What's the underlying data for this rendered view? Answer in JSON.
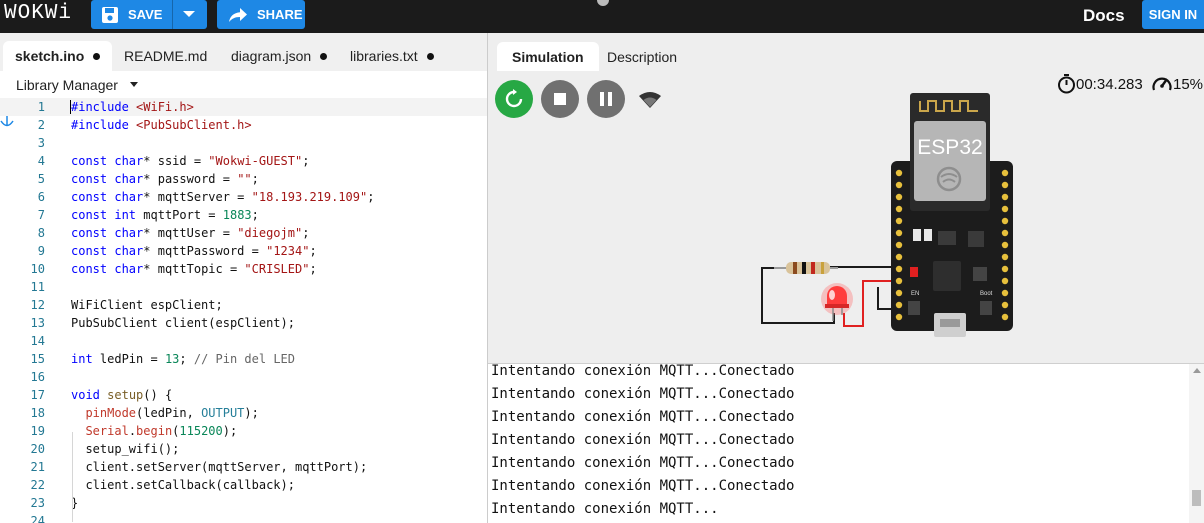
{
  "topbar": {
    "logo": "WOKWi",
    "save_label": "SAVE",
    "share_label": "SHARE",
    "docs_label": "Docs",
    "signin_label": "SIGN IN",
    "accent": "#1e88e5"
  },
  "editor": {
    "tabs": [
      {
        "label": "sketch.ino",
        "unsaved": true,
        "active": true
      },
      {
        "label": "README.md",
        "unsaved": false
      },
      {
        "label": "diagram.json",
        "unsaved": true
      },
      {
        "label": "libraries.txt",
        "unsaved": true
      }
    ],
    "library_manager": "Library Manager",
    "code": [
      {
        "n": "1",
        "html": "<span class='t-kw'>#include</span> <span class='t-str'>&lt;WiFi.h&gt;</span>",
        "current": true
      },
      {
        "n": "2",
        "html": "<span class='t-kw'>#include</span> <span class='t-str'>&lt;PubSubClient.h&gt;</span>"
      },
      {
        "n": "3",
        "html": ""
      },
      {
        "n": "4",
        "html": "<span class='t-kw'>const</span> <span class='t-kw'>char</span>* ssid = <span class='t-str'>\"Wokwi-GUEST\"</span>;"
      },
      {
        "n": "5",
        "html": "<span class='t-kw'>const</span> <span class='t-kw'>char</span>* password = <span class='t-str'>\"\"</span>;"
      },
      {
        "n": "6",
        "html": "<span class='t-kw'>const</span> <span class='t-kw'>char</span>* mqttServer = <span class='t-str'>\"18.193.219.109\"</span>;"
      },
      {
        "n": "7",
        "html": "<span class='t-kw'>const</span> <span class='t-kw'>int</span> mqttPort = <span class='t-num'>1883</span>;"
      },
      {
        "n": "8",
        "html": "<span class='t-kw'>const</span> <span class='t-kw'>char</span>* mqttUser = <span class='t-str'>\"diegojm\"</span>;"
      },
      {
        "n": "9",
        "html": "<span class='t-kw'>const</span> <span class='t-kw'>char</span>* mqttPassword = <span class='t-str'>\"1234\"</span>;"
      },
      {
        "n": "10",
        "html": "<span class='t-kw'>const</span> <span class='t-kw'>char</span>* mqttTopic = <span class='t-str'>\"CRISLED\"</span>;"
      },
      {
        "n": "11",
        "html": ""
      },
      {
        "n": "12",
        "html": "WiFiClient espClient;"
      },
      {
        "n": "13",
        "html": "PubSubClient client(espClient);"
      },
      {
        "n": "14",
        "html": ""
      },
      {
        "n": "15",
        "html": "<span class='t-kw'>int</span> ledPin = <span class='t-num'>13</span>; <span class='t-cm t-dim'>// Pin del LED</span>"
      },
      {
        "n": "16",
        "html": ""
      },
      {
        "n": "17",
        "html": "<span class='t-kw'>void</span> <span class='t-fn'>setup</span>() {"
      },
      {
        "n": "18",
        "html": "  <span class='t-ar'>pinMode</span>(ledPin, <span class='t-ty'>OUTPUT</span>);"
      },
      {
        "n": "19",
        "html": "  <span class='t-ar'>Serial</span>.<span class='t-ar'>begin</span>(<span class='t-num'>115200</span>);"
      },
      {
        "n": "20",
        "html": "  setup_wifi();"
      },
      {
        "n": "21",
        "html": "  client.setServer(mqttServer, mqttPort);"
      },
      {
        "n": "22",
        "html": "  client.setCallback(callback);"
      },
      {
        "n": "23",
        "html": "}"
      },
      {
        "n": "24",
        "html": ""
      }
    ]
  },
  "simulation": {
    "tabs": [
      "Simulation",
      "Description"
    ],
    "elapsed": "00:34.283",
    "speed": "15%",
    "chip_label": "ESP32",
    "pin_en": "EN",
    "pin_boot": "Boot"
  },
  "serial": {
    "lines": [
      "Intentando conexión MQTT...Conectado",
      "Intentando conexión MQTT...Conectado",
      "Intentando conexión MQTT...Conectado",
      "Intentando conexión MQTT...Conectado",
      "Intentando conexión MQTT...Conectado",
      "Intentando conexión MQTT...Conectado",
      "Intentando conexión MQTT..."
    ]
  }
}
